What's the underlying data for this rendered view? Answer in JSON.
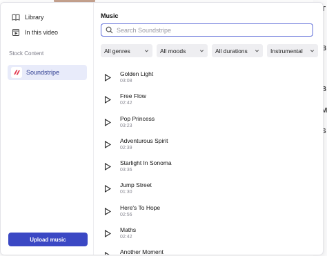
{
  "background": {
    "right_letters": [
      "T",
      "B",
      "B",
      "M",
      "S"
    ]
  },
  "sidebar": {
    "items": [
      {
        "label": "Library",
        "icon": "book-icon"
      },
      {
        "label": "In this video",
        "icon": "video-frame-icon"
      }
    ],
    "section_label": "Stock Content",
    "provider": {
      "label": "Soundstripe",
      "icon": "soundstripe-logo",
      "color": "#e2374f"
    },
    "upload_label": "Upload music"
  },
  "main": {
    "heading": "Music",
    "search": {
      "placeholder": "Search Soundstripe",
      "value": ""
    },
    "filters": [
      {
        "label": "All genres"
      },
      {
        "label": "All moods"
      },
      {
        "label": "All durations"
      },
      {
        "label": "Instrumental"
      }
    ],
    "tracks": [
      {
        "title": "Golden Light",
        "duration": "03:08"
      },
      {
        "title": "Free Flow",
        "duration": "02:42"
      },
      {
        "title": "Pop Princess",
        "duration": "03:23"
      },
      {
        "title": "Adventurous Spirit",
        "duration": "02:39"
      },
      {
        "title": "Starlight In Sonoma",
        "duration": "03:36"
      },
      {
        "title": "Jump Street",
        "duration": "01:30"
      },
      {
        "title": "Here's To Hope",
        "duration": "02:56"
      },
      {
        "title": "Maths",
        "duration": "02:42"
      },
      {
        "title": "Another Moment",
        "duration": ""
      }
    ]
  },
  "colors": {
    "accent": "#3b48c4",
    "selected_bg": "#e8ebfa",
    "search_border": "#5b6ad8"
  }
}
